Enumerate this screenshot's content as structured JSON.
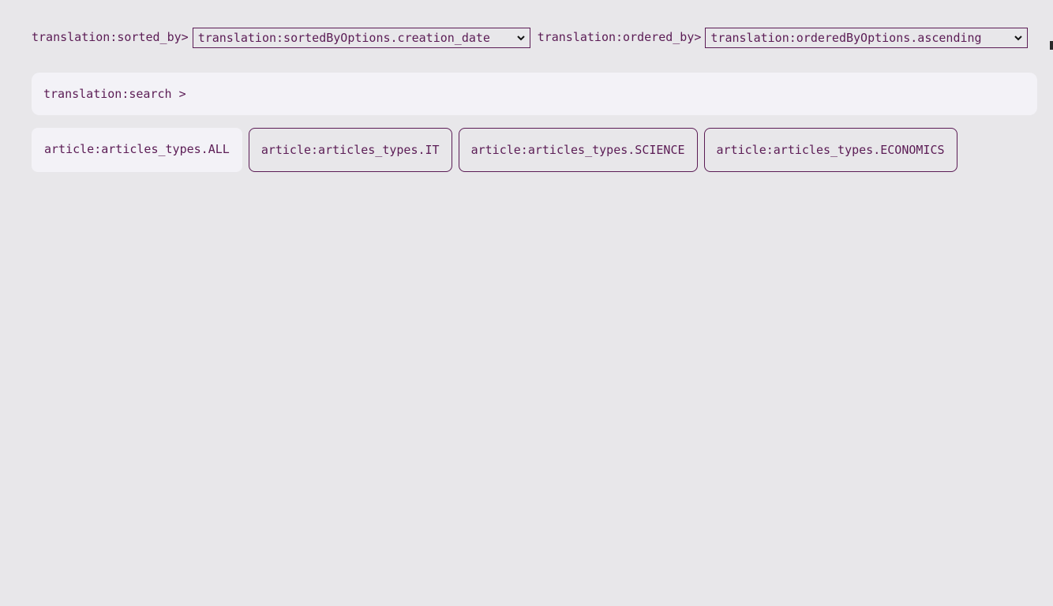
{
  "sort": {
    "sorted_by_label": "translation:sorted_by>",
    "sorted_by_value": "translation:sortedByOptions.creation_date",
    "ordered_by_label": "translation:ordered_by>",
    "ordered_by_value": "translation:orderedByOptions.ascending"
  },
  "search": {
    "label": "translation:search >"
  },
  "tabs": [
    {
      "label": "article:articles_types.ALL",
      "active": true
    },
    {
      "label": "article:articles_types.IT",
      "active": false
    },
    {
      "label": "article:articles_types.SCIENCE",
      "active": false
    },
    {
      "label": "article:articles_types.ECONOMICS",
      "active": false
    }
  ],
  "icons": {
    "select_arrow": "chevron-down-icon"
  },
  "colors": {
    "background": "#e8e7ea",
    "accent": "#5b1c55",
    "panel": "#f3f2f7"
  }
}
